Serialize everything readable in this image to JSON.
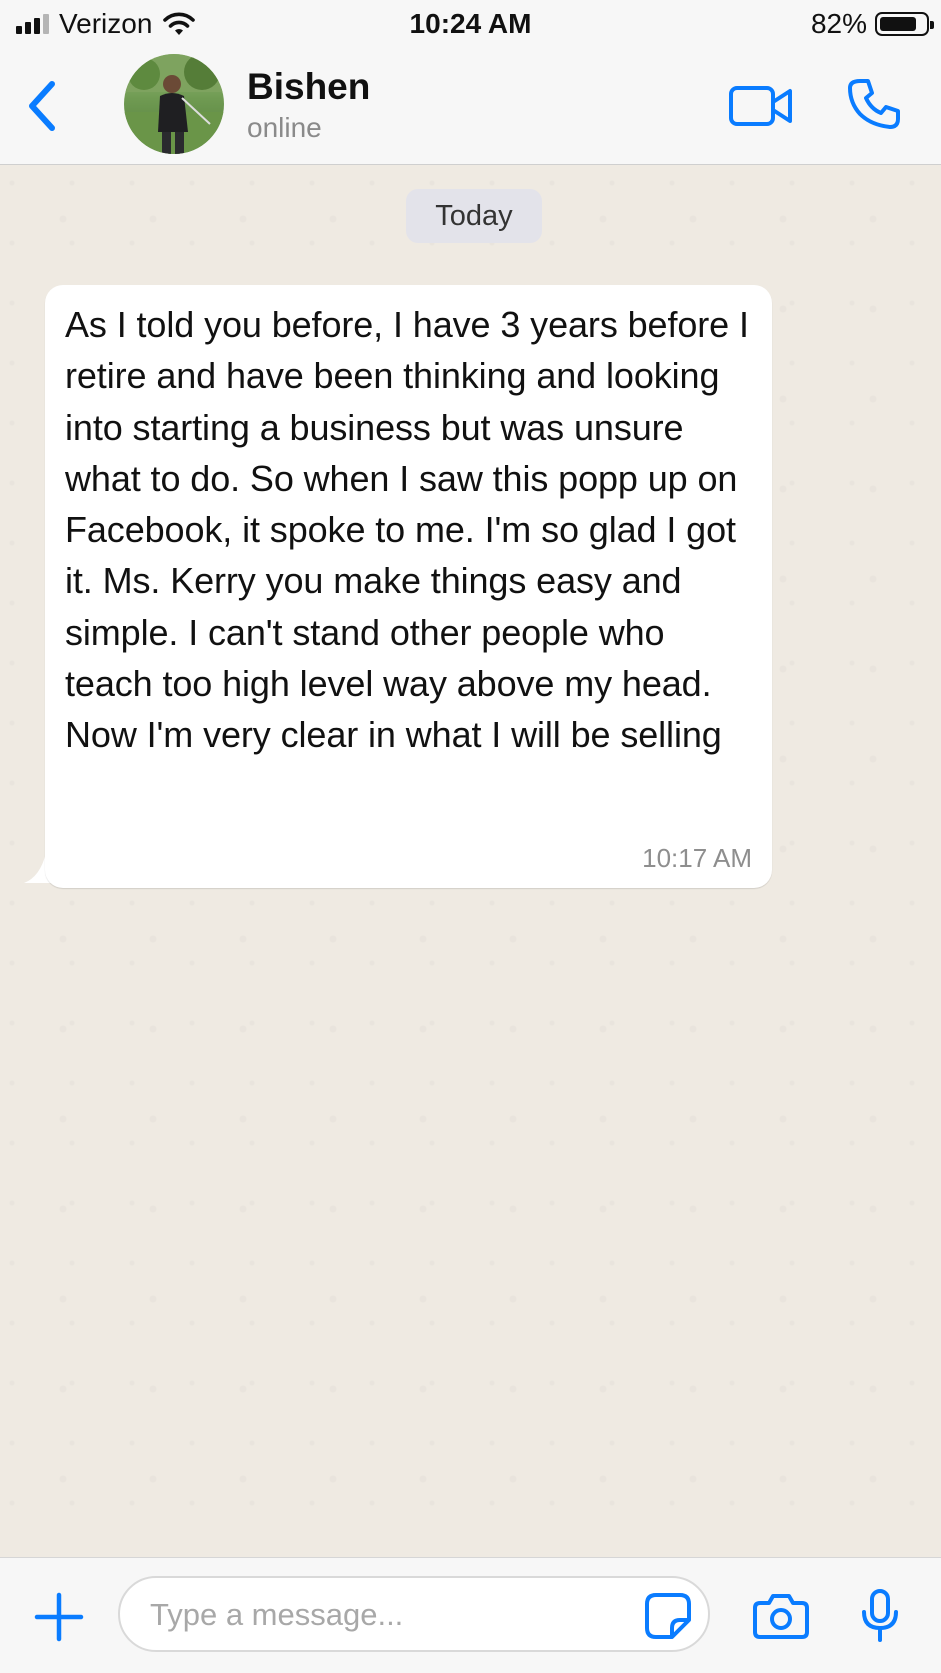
{
  "status_bar": {
    "carrier": "Verizon",
    "time": "10:24 AM",
    "battery": "82%",
    "battery_level": 0.82,
    "signal_bars_active": 3,
    "signal_bars_total": 4,
    "icons": [
      "signal-icon",
      "wifi-icon",
      "battery-icon"
    ]
  },
  "header": {
    "contact_name": "Bishen",
    "contact_status": "online",
    "icons": [
      "chevron-left-icon",
      "video-camera-icon",
      "phone-icon"
    ]
  },
  "chat": {
    "date_label": "Today",
    "messages": [
      {
        "text": "As I told you before, I have 3 years before I retire and have been thinking and looking into starting a business but was unsure what to do. So when I saw this popp up on Facebook, it spoke to me. I'm so glad I got it. Ms. Kerry you make things easy and simple. I can't stand other people who teach too high level way above my head. Now I'm very clear in what I will be selling",
        "time": "10:17 AM",
        "direction": "incoming"
      }
    ]
  },
  "input_bar": {
    "placeholder": "Type a message...",
    "value": "",
    "icons": [
      "plus-icon",
      "sticker-icon",
      "camera-icon",
      "microphone-icon"
    ]
  },
  "colors": {
    "accent": "#0a7cff",
    "chat_background": "#efeae2",
    "bar_background": "#f7f7f7",
    "bubble": "#ffffff"
  }
}
